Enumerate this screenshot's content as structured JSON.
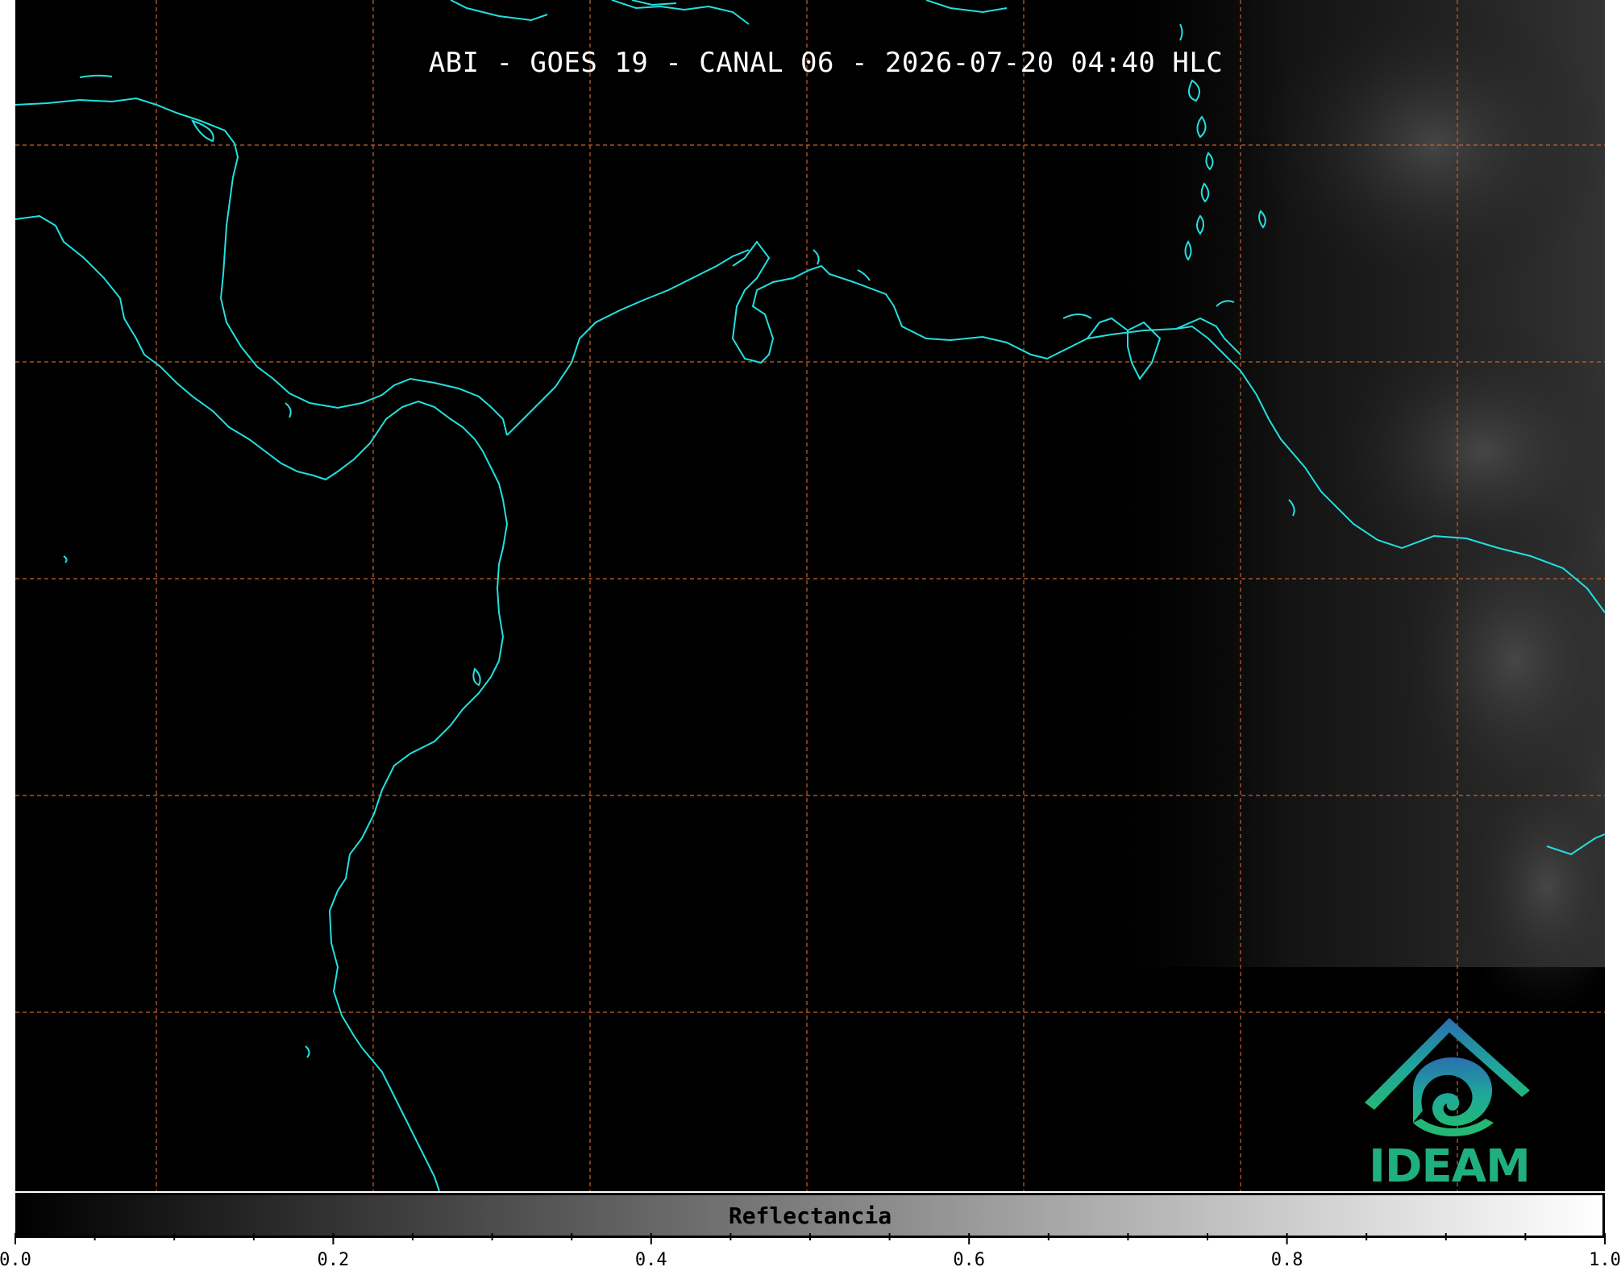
{
  "map": {
    "title": "ABI - GOES 19 - CANAL 06 - 2026-07-20 04:40 HLC",
    "background_color": "#000000",
    "coastline_color": "#22e0e0",
    "gridline_color": "#c86428",
    "gridlines": "dashed"
  },
  "logo": {
    "text": "IDEAM",
    "icon": "ideam-logo-icon",
    "colors": [
      "#2a6fb0",
      "#1fa89a",
      "#24b874"
    ]
  },
  "colorbar": {
    "label": "Reflectancia",
    "range": [
      0.0,
      1.0
    ],
    "colormap": [
      "#000000",
      "#ffffff"
    ],
    "tick_labels": [
      "0.0",
      "0.2",
      "0.4",
      "0.6",
      "0.8",
      "1.0"
    ],
    "tick_values": [
      0.0,
      0.2,
      0.4,
      0.6,
      0.8,
      1.0
    ],
    "minor_tick_step": 0.05
  }
}
